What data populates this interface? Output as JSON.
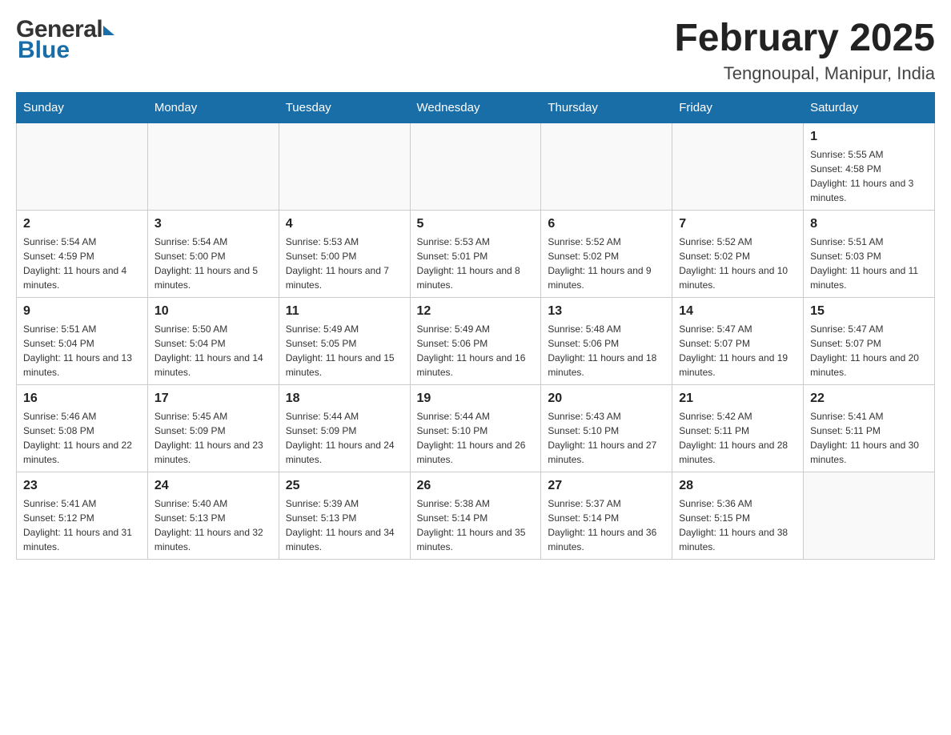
{
  "logo": {
    "general": "General",
    "blue": "Blue"
  },
  "title": "February 2025",
  "subtitle": "Tengnoupal, Manipur, India",
  "days_of_week": [
    "Sunday",
    "Monday",
    "Tuesday",
    "Wednesday",
    "Thursday",
    "Friday",
    "Saturday"
  ],
  "weeks": [
    [
      {
        "day": "",
        "info": ""
      },
      {
        "day": "",
        "info": ""
      },
      {
        "day": "",
        "info": ""
      },
      {
        "day": "",
        "info": ""
      },
      {
        "day": "",
        "info": ""
      },
      {
        "day": "",
        "info": ""
      },
      {
        "day": "1",
        "info": "Sunrise: 5:55 AM\nSunset: 4:58 PM\nDaylight: 11 hours and 3 minutes."
      }
    ],
    [
      {
        "day": "2",
        "info": "Sunrise: 5:54 AM\nSunset: 4:59 PM\nDaylight: 11 hours and 4 minutes."
      },
      {
        "day": "3",
        "info": "Sunrise: 5:54 AM\nSunset: 5:00 PM\nDaylight: 11 hours and 5 minutes."
      },
      {
        "day": "4",
        "info": "Sunrise: 5:53 AM\nSunset: 5:00 PM\nDaylight: 11 hours and 7 minutes."
      },
      {
        "day": "5",
        "info": "Sunrise: 5:53 AM\nSunset: 5:01 PM\nDaylight: 11 hours and 8 minutes."
      },
      {
        "day": "6",
        "info": "Sunrise: 5:52 AM\nSunset: 5:02 PM\nDaylight: 11 hours and 9 minutes."
      },
      {
        "day": "7",
        "info": "Sunrise: 5:52 AM\nSunset: 5:02 PM\nDaylight: 11 hours and 10 minutes."
      },
      {
        "day": "8",
        "info": "Sunrise: 5:51 AM\nSunset: 5:03 PM\nDaylight: 11 hours and 11 minutes."
      }
    ],
    [
      {
        "day": "9",
        "info": "Sunrise: 5:51 AM\nSunset: 5:04 PM\nDaylight: 11 hours and 13 minutes."
      },
      {
        "day": "10",
        "info": "Sunrise: 5:50 AM\nSunset: 5:04 PM\nDaylight: 11 hours and 14 minutes."
      },
      {
        "day": "11",
        "info": "Sunrise: 5:49 AM\nSunset: 5:05 PM\nDaylight: 11 hours and 15 minutes."
      },
      {
        "day": "12",
        "info": "Sunrise: 5:49 AM\nSunset: 5:06 PM\nDaylight: 11 hours and 16 minutes."
      },
      {
        "day": "13",
        "info": "Sunrise: 5:48 AM\nSunset: 5:06 PM\nDaylight: 11 hours and 18 minutes."
      },
      {
        "day": "14",
        "info": "Sunrise: 5:47 AM\nSunset: 5:07 PM\nDaylight: 11 hours and 19 minutes."
      },
      {
        "day": "15",
        "info": "Sunrise: 5:47 AM\nSunset: 5:07 PM\nDaylight: 11 hours and 20 minutes."
      }
    ],
    [
      {
        "day": "16",
        "info": "Sunrise: 5:46 AM\nSunset: 5:08 PM\nDaylight: 11 hours and 22 minutes."
      },
      {
        "day": "17",
        "info": "Sunrise: 5:45 AM\nSunset: 5:09 PM\nDaylight: 11 hours and 23 minutes."
      },
      {
        "day": "18",
        "info": "Sunrise: 5:44 AM\nSunset: 5:09 PM\nDaylight: 11 hours and 24 minutes."
      },
      {
        "day": "19",
        "info": "Sunrise: 5:44 AM\nSunset: 5:10 PM\nDaylight: 11 hours and 26 minutes."
      },
      {
        "day": "20",
        "info": "Sunrise: 5:43 AM\nSunset: 5:10 PM\nDaylight: 11 hours and 27 minutes."
      },
      {
        "day": "21",
        "info": "Sunrise: 5:42 AM\nSunset: 5:11 PM\nDaylight: 11 hours and 28 minutes."
      },
      {
        "day": "22",
        "info": "Sunrise: 5:41 AM\nSunset: 5:11 PM\nDaylight: 11 hours and 30 minutes."
      }
    ],
    [
      {
        "day": "23",
        "info": "Sunrise: 5:41 AM\nSunset: 5:12 PM\nDaylight: 11 hours and 31 minutes."
      },
      {
        "day": "24",
        "info": "Sunrise: 5:40 AM\nSunset: 5:13 PM\nDaylight: 11 hours and 32 minutes."
      },
      {
        "day": "25",
        "info": "Sunrise: 5:39 AM\nSunset: 5:13 PM\nDaylight: 11 hours and 34 minutes."
      },
      {
        "day": "26",
        "info": "Sunrise: 5:38 AM\nSunset: 5:14 PM\nDaylight: 11 hours and 35 minutes."
      },
      {
        "day": "27",
        "info": "Sunrise: 5:37 AM\nSunset: 5:14 PM\nDaylight: 11 hours and 36 minutes."
      },
      {
        "day": "28",
        "info": "Sunrise: 5:36 AM\nSunset: 5:15 PM\nDaylight: 11 hours and 38 minutes."
      },
      {
        "day": "",
        "info": ""
      }
    ]
  ]
}
